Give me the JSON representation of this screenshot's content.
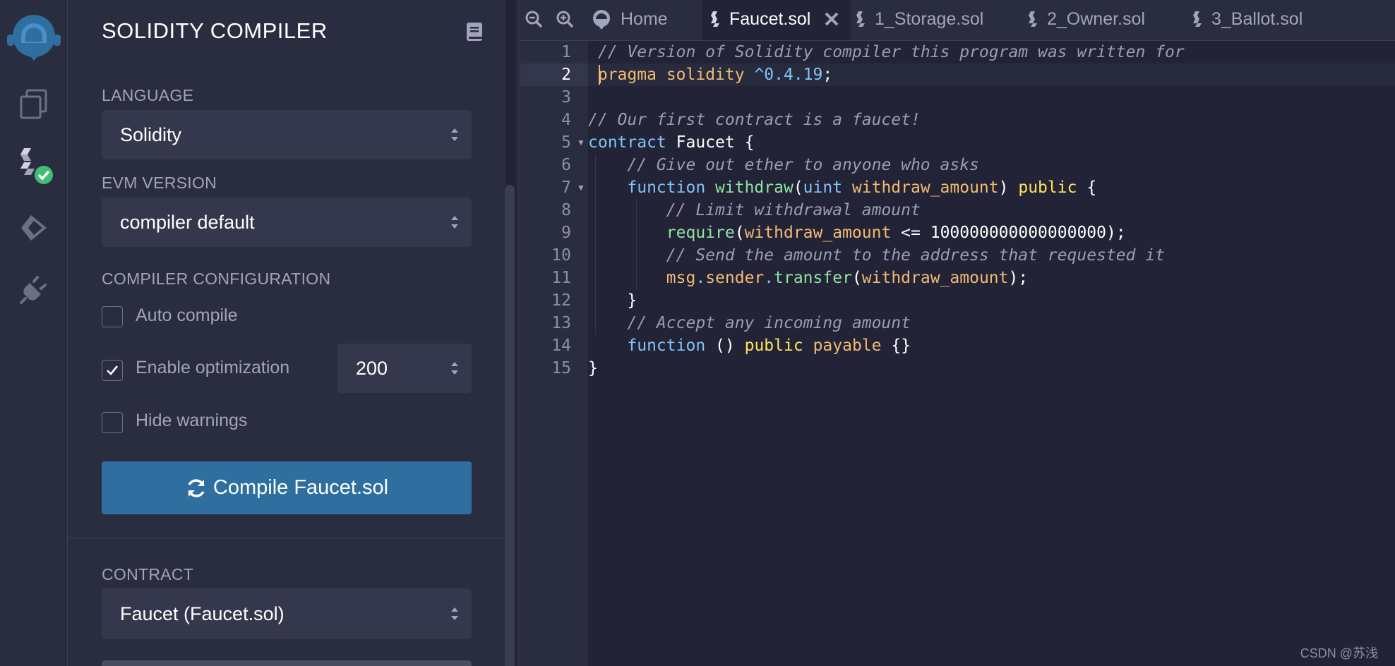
{
  "iconbar": {
    "items": [
      {
        "name": "remix-logo-icon"
      },
      {
        "name": "file-explorer-icon"
      },
      {
        "name": "solidity-compiler-icon"
      },
      {
        "name": "deploy-run-icon"
      },
      {
        "name": "plugin-manager-icon"
      }
    ]
  },
  "panel": {
    "title": "SOLIDITY COMPILER",
    "language_label": "LANGUAGE",
    "language_value": "Solidity",
    "evm_label": "EVM VERSION",
    "evm_value": "compiler default",
    "config_label": "COMPILER CONFIGURATION",
    "auto_compile_label": "Auto compile",
    "auto_compile_checked": false,
    "optimization_label": "Enable optimization",
    "optimization_checked": true,
    "optimization_runs": "200",
    "hide_warnings_label": "Hide warnings",
    "hide_warnings_checked": false,
    "compile_button_label": "Compile Faucet.sol",
    "contract_label": "CONTRACT",
    "contract_value": "Faucet (Faucet.sol)"
  },
  "tabs": {
    "home": "Home",
    "files": [
      "Faucet.sol",
      "1_Storage.sol",
      "2_Owner.sol",
      "3_Ballot.sol"
    ],
    "active": "Faucet.sol"
  },
  "editor": {
    "line_numbers": [
      "1",
      "2",
      "3",
      "4",
      "5",
      "6",
      "7",
      "8",
      "9",
      "10",
      "11",
      "12",
      "13",
      "14",
      "15"
    ],
    "active_line": 2,
    "lines": [
      " // Version of Solidity compiler this program was written for",
      " pragma solidity ^0.4.19;",
      "",
      "// Our first contract is a faucet!",
      "contract Faucet {",
      "    // Give out ether to anyone who asks",
      "    function withdraw(uint withdraw_amount) public {",
      "        // Limit withdrawal amount",
      "        require(withdraw_amount <= 100000000000000000);",
      "        // Send the amount to the address that requested it",
      "        msg.sender.transfer(withdraw_amount);",
      "    }",
      "    // Accept any incoming amount",
      "    function () public payable {}",
      "}"
    ]
  },
  "watermark": "CSDN @苏浅",
  "colors": {
    "background": "#222336",
    "panel": "#2a2c3f",
    "accent": "#2f6fa0",
    "success": "#3fbf75"
  }
}
